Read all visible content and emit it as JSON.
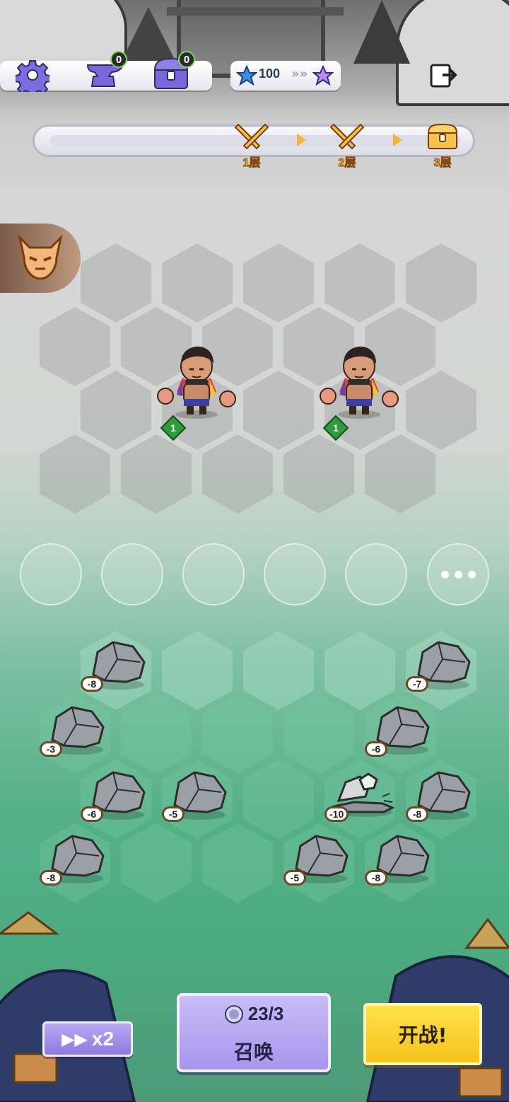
{
  "topbar": {
    "settings_icon": "gear-icon",
    "anvil_count": "0",
    "chest_count": "0",
    "star_value": "100",
    "exit_icon": "exit-icon"
  },
  "progress": {
    "stages": [
      {
        "label": "1层",
        "icon": "crossed-swords-icon",
        "state": "current"
      },
      {
        "label": "2层",
        "icon": "crossed-swords-icon",
        "state": "locked"
      },
      {
        "label": "3层",
        "icon": "treasure-chest-icon",
        "state": "locked"
      }
    ]
  },
  "boss_tab": {
    "icon": "demon-mask-icon"
  },
  "board": {
    "enemy_units": [
      {
        "level": "1"
      },
      {
        "level": "1"
      }
    ],
    "rocks": [
      {
        "value": "-8"
      },
      {
        "value": "-7"
      },
      {
        "value": "-3"
      },
      {
        "value": "-6"
      },
      {
        "value": "-6"
      },
      {
        "value": "-5"
      },
      {
        "value": "-10"
      },
      {
        "value": "-8"
      },
      {
        "value": "-8"
      },
      {
        "value": "-5"
      },
      {
        "value": "-8"
      }
    ]
  },
  "controls": {
    "speed_label": "x2",
    "summon_cost": "23/3",
    "summon_label": "召唤",
    "fight_label": "开战!"
  },
  "colors": {
    "accent_gold": "#f3b43d",
    "summon_purple": "#a795ec",
    "fight_yellow": "#f4c21a",
    "level_green": "#2f9b3a"
  }
}
